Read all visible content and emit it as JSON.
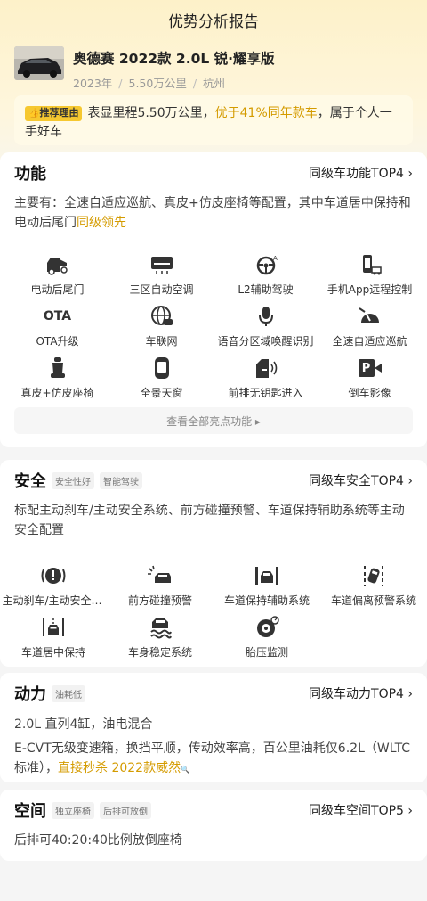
{
  "header": {
    "title": "优势分析报告"
  },
  "car": {
    "name": "奥德赛 2022款 2.0L 锐·耀享版",
    "year": "2023年",
    "mileage": "5.50万公里",
    "city": "杭州",
    "sep": "/"
  },
  "reason": {
    "tag": "推荐理由",
    "text_a": "表显里程5.50万公里，",
    "highlight": "优于41%同年款车",
    "text_b": "，属于个人一手好车"
  },
  "function": {
    "title": "功能",
    "link": "同级车功能TOP4 ›",
    "desc": "主要有：全速自适应巡航、真皮+仿皮座椅等配置，其中车道居中保持和电动后尾门",
    "desc_hl": "同级领先",
    "items": [
      {
        "label": "电动后尾门",
        "icon": "tailgate-icon"
      },
      {
        "label": "三区自动空调",
        "icon": "air-conditioner-icon"
      },
      {
        "label": "L2辅助驾驶",
        "icon": "steering-wheel-icon"
      },
      {
        "label": "手机App远程控制",
        "icon": "phone-remote-icon"
      },
      {
        "label": "OTA升级",
        "icon": "ota-icon",
        "glyph": "OTA"
      },
      {
        "label": "车联网",
        "icon": "globe-car-icon"
      },
      {
        "label": "语音分区域唤醒识别",
        "icon": "microphone-icon"
      },
      {
        "label": "全速自适应巡航",
        "icon": "speedometer-icon"
      },
      {
        "label": "真皮+仿皮座椅",
        "icon": "seat-icon"
      },
      {
        "label": "全景天窗",
        "icon": "sunroof-icon"
      },
      {
        "label": "前排无钥匙进入",
        "icon": "keyless-door-icon"
      },
      {
        "label": "倒车影像",
        "icon": "parking-camera-icon",
        "glyph": "P"
      }
    ],
    "more": "查看全部亮点功能 ▸"
  },
  "safety": {
    "title": "安全",
    "chips": [
      "安全性好",
      "智能驾驶"
    ],
    "link": "同级车安全TOP4 ›",
    "desc": "标配主动刹车/主动安全系统、前方碰撞预警、车道保持辅助系统等主动安全配置",
    "items": [
      {
        "label": "主动刹车/主动安全系统",
        "icon": "brake-warning-icon"
      },
      {
        "label": "前方碰撞预警",
        "icon": "collision-warning-icon"
      },
      {
        "label": "车道保持辅助系统",
        "icon": "lane-keep-icon"
      },
      {
        "label": "车道偏离预警系统",
        "icon": "lane-departure-icon"
      },
      {
        "label": "车道居中保持",
        "icon": "lane-center-icon"
      },
      {
        "label": "车身稳定系统",
        "icon": "stability-icon"
      },
      {
        "label": "胎压监测",
        "icon": "tire-pressure-icon"
      }
    ]
  },
  "power": {
    "title": "动力",
    "chips": [
      "油耗低"
    ],
    "link": "同级车动力TOP4 ›",
    "line1": "2.0L 直列4缸，油电混合",
    "line2": "E-CVT无级变速箱，换挡平顺，传动效率高，百公里油耗仅6.2L（WLTC标准），",
    "line2_hl": "直接秒杀 2022款威然",
    "search_glyph": "🔍"
  },
  "space": {
    "title": "空间",
    "chips": [
      "独立座椅",
      "后排可放倒"
    ],
    "link": "同级车空间TOP5 ›",
    "desc": "后排可40:20:40比例放倒座椅"
  },
  "colors": {
    "accent": "#d49b00",
    "tag": "#f6c830"
  }
}
